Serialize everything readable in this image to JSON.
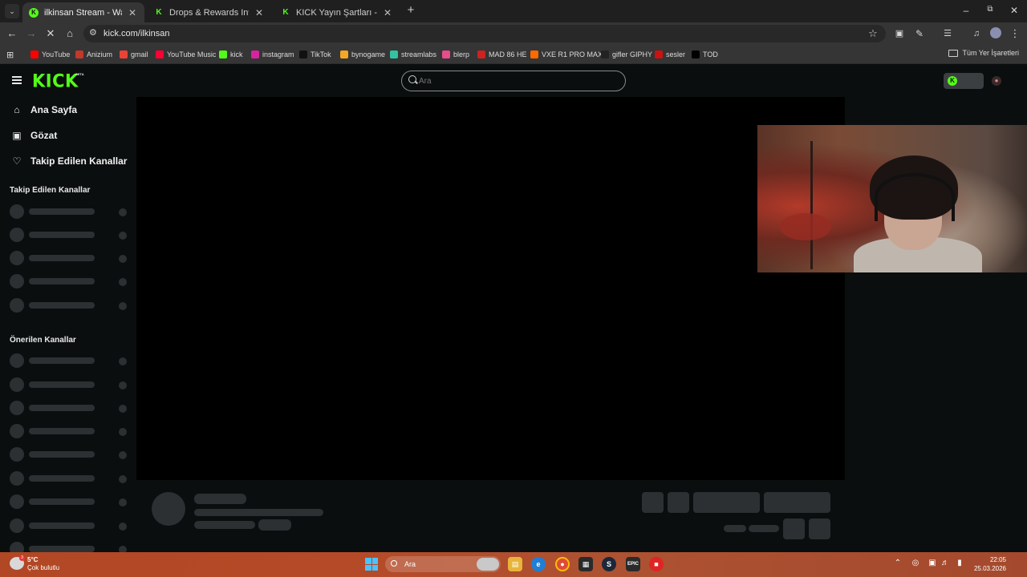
{
  "browser": {
    "tabs": [
      {
        "label": "ilkinsan Stream - Watch Live on",
        "active": true
      },
      {
        "label": "Drops & Rewards Inventory - Ki",
        "active": false
      },
      {
        "label": "KICK Yayın Şartları - Kick Stream",
        "active": false
      }
    ],
    "url": "kick.com/ilkinsan",
    "bookmarks": [
      {
        "label": "YouTube",
        "color": "#ff0000"
      },
      {
        "label": "Anizium",
        "color": "#c0392b"
      },
      {
        "label": "gmail",
        "color": "#ea4335"
      },
      {
        "label": "YouTube Music",
        "color": "#ff0033"
      },
      {
        "label": "kick",
        "color": "#53fc18"
      },
      {
        "label": "instagram",
        "color": "#d6249f"
      },
      {
        "label": "TikTok",
        "color": "#111111"
      },
      {
        "label": "bynogame",
        "color": "#f5a623"
      },
      {
        "label": "streamlabs",
        "color": "#31c3a2"
      },
      {
        "label": "blerp",
        "color": "#e84c8b"
      },
      {
        "label": "MAD 86 HE",
        "color": "#cc2222"
      },
      {
        "label": "VXE R1 PRO MAX",
        "color": "#ff6a00"
      },
      {
        "label": "gifler GIPHY",
        "color": "#222222"
      },
      {
        "label": "sesler",
        "color": "#cc1111"
      },
      {
        "label": "TOD",
        "color": "#000000"
      }
    ],
    "all_bookmarks": "Tüm Yer İşaretleri"
  },
  "site": {
    "logo": "KICK",
    "logo_badge": "BETA",
    "search_placeholder": "Ara",
    "accent": "#53fc18"
  },
  "sidebar": {
    "nav": [
      {
        "label": "Ana Sayfa",
        "icon": "home-icon"
      },
      {
        "label": "Gözat",
        "icon": "browse-icon"
      },
      {
        "label": "Takip Edilen Kanallar",
        "icon": "heart-icon"
      }
    ],
    "followed_title": "Takip Edilen Kanallar",
    "recommended_title": "Önerilen Kanallar"
  },
  "taskbar": {
    "temperature": "5°C",
    "weather": "Çok bulutlu",
    "weather_badge": "3",
    "search": "Ara",
    "time": "22:05",
    "date": "25.03.2026"
  }
}
